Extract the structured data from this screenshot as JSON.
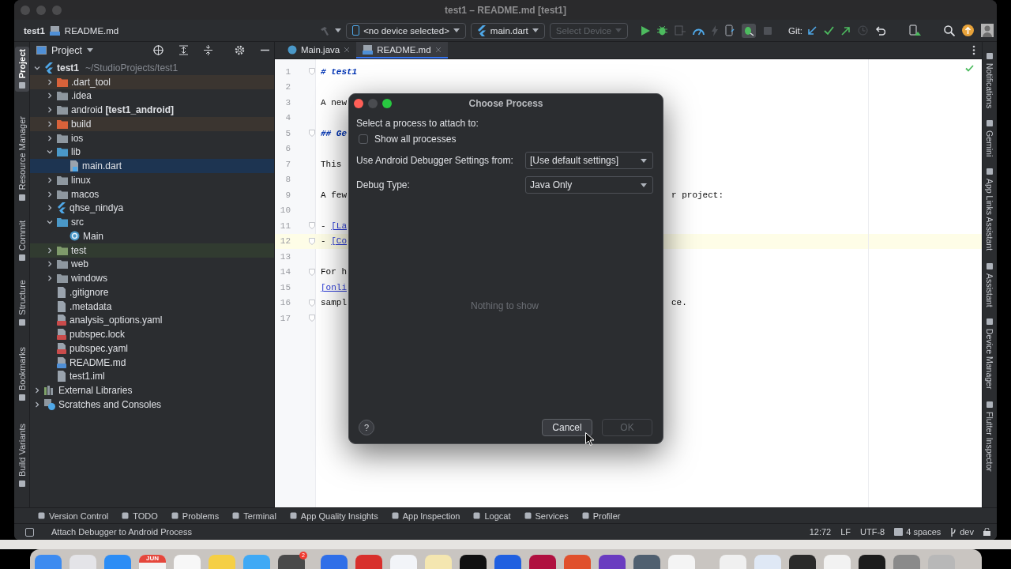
{
  "window": {
    "title": "test1 – README.md [test1]"
  },
  "toolbar": {
    "project": "test1",
    "file": "README.md",
    "device_selector": "<no device selected>",
    "run_config": "main.dart",
    "device_dropdown": {
      "label": "Select Device",
      "disabled": true
    },
    "git_label": "Git:"
  },
  "left_stripe": [
    {
      "label": "Project",
      "selected": true
    },
    {
      "label": "Resource Manager",
      "selected": false
    },
    {
      "label": "Commit",
      "selected": false
    },
    {
      "label": "Structure",
      "selected": false
    },
    {
      "label": "Bookmarks",
      "selected": false
    },
    {
      "label": "Build Variants",
      "selected": false
    }
  ],
  "right_stripe": [
    {
      "label": "Notifications",
      "selected": false
    },
    {
      "label": "Gemini",
      "selected": false
    },
    {
      "label": "App Links Assistant",
      "selected": false
    },
    {
      "label": "Assistant",
      "selected": false
    },
    {
      "label": "Device Manager",
      "selected": false
    },
    {
      "label": "Flutter Inspector",
      "selected": false
    }
  ],
  "project_panel": {
    "title": "Project",
    "tree": [
      {
        "label": "test1",
        "path": "~/StudioProjects/test1",
        "kind": "flutter-module",
        "expanded": true,
        "selected": false,
        "children": [
          {
            "label": ".dart_tool",
            "kind": "folder-excluded",
            "expanded": false,
            "selected": false
          },
          {
            "label": ".idea",
            "kind": "folder",
            "expanded": false,
            "selected": false
          },
          {
            "label": "android **[test1_android]**",
            "kind": "folder-module",
            "expanded": false,
            "selected": false
          },
          {
            "label": "build",
            "kind": "folder-excluded",
            "expanded": false,
            "selected": false
          },
          {
            "label": "ios",
            "kind": "folder-module",
            "expanded": false,
            "selected": false
          },
          {
            "label": "lib",
            "kind": "folder-source",
            "expanded": true,
            "selected": false,
            "children": [
              {
                "label": "main.dart",
                "kind": "dart-file",
                "selected": true
              }
            ]
          },
          {
            "label": "linux",
            "kind": "folder",
            "expanded": false,
            "selected": false
          },
          {
            "label": "macos",
            "kind": "folder",
            "expanded": false,
            "selected": false
          },
          {
            "label": "qhse_nindya",
            "kind": "flutter-module",
            "expanded": false,
            "selected": false
          },
          {
            "label": "src",
            "kind": "folder-source",
            "expanded": true,
            "selected": false,
            "children": [
              {
                "label": "Main",
                "kind": "java-class",
                "selected": false
              }
            ]
          },
          {
            "label": "test",
            "kind": "folder-test",
            "expanded": false,
            "selected": false
          },
          {
            "label": "web",
            "kind": "folder-module",
            "expanded": false,
            "selected": false
          },
          {
            "label": "windows",
            "kind": "folder",
            "expanded": false,
            "selected": false
          },
          {
            "label": ".gitignore",
            "kind": "text-file",
            "selected": false
          },
          {
            "label": ".metadata",
            "kind": "text-file",
            "selected": false
          },
          {
            "label": "analysis_options.yaml",
            "kind": "yaml-file",
            "selected": false
          },
          {
            "label": "pubspec.lock",
            "kind": "yaml-file",
            "selected": false
          },
          {
            "label": "pubspec.yaml",
            "kind": "yaml-file",
            "selected": false
          },
          {
            "label": "README.md",
            "kind": "markdown-file",
            "selected": false
          },
          {
            "label": "test1.iml",
            "kind": "text-file",
            "selected": false
          }
        ]
      },
      {
        "label": "External Libraries",
        "kind": "libraries",
        "expanded": false,
        "selected": false
      },
      {
        "label": "Scratches and Consoles",
        "kind": "scratches",
        "expanded": false,
        "selected": false
      }
    ]
  },
  "editor": {
    "tabs": [
      {
        "label": "Main.java",
        "kind": "java",
        "selected": false
      },
      {
        "label": "README.md",
        "kind": "markdown",
        "selected": true
      }
    ],
    "lines": [
      {
        "number": "1",
        "kind": "heading",
        "text": "# test1",
        "fold": true,
        "current": false
      },
      {
        "number": "2",
        "kind": "text",
        "fold": false,
        "current": false
      },
      {
        "number": "3",
        "kind": "text",
        "text": "A new",
        "fold": false,
        "current": false
      },
      {
        "number": "4",
        "kind": "text",
        "fold": false,
        "current": false
      },
      {
        "number": "5",
        "kind": "heading",
        "text": "## Ge",
        "fold": true,
        "current": false
      },
      {
        "number": "6",
        "kind": "text",
        "fold": false,
        "current": false
      },
      {
        "number": "7",
        "kind": "text",
        "text": "This",
        "fold": false,
        "current": false
      },
      {
        "number": "8",
        "kind": "text",
        "fold": false,
        "current": false
      },
      {
        "number": "9",
        "kind": "text",
        "text": "A few",
        "right": "r project:",
        "fold": false,
        "current": false
      },
      {
        "number": "10",
        "kind": "text",
        "fold": false,
        "current": false
      },
      {
        "number": "11",
        "kind": "link-item",
        "bullet": "-",
        "text": "[La",
        "fold": true,
        "current": false
      },
      {
        "number": "12",
        "kind": "link-item",
        "bullet": "-",
        "text": "[Co",
        "fold": true,
        "current": true
      },
      {
        "number": "13",
        "kind": "text",
        "fold": false,
        "current": false
      },
      {
        "number": "14",
        "kind": "text",
        "text": "For h",
        "fold": true,
        "current": false
      },
      {
        "number": "15",
        "kind": "link",
        "text": "[onli",
        "fold": false,
        "current": false
      },
      {
        "number": "16",
        "kind": "text",
        "text": "sampl",
        "right": "ce.",
        "fold": true,
        "current": false
      },
      {
        "number": "17",
        "kind": "text",
        "fold": true,
        "current": false
      }
    ]
  },
  "dialog": {
    "title": "Choose Process",
    "prompt": "Select a process to attach to:",
    "show_all": {
      "label": "Show all processes",
      "checked": false
    },
    "fields": [
      {
        "label": "Use Android Debugger Settings from:",
        "value": "[Use default settings]"
      },
      {
        "label": "Debug Type:",
        "value": "Java Only"
      }
    ],
    "empty_text": "Nothing to show",
    "help": "?",
    "buttons": [
      {
        "label": "Cancel",
        "disabled": false
      },
      {
        "label": "OK",
        "disabled": true
      }
    ]
  },
  "tool_windows": [
    "Version Control",
    "TODO",
    "Problems",
    "Terminal",
    "App Quality Insights",
    "App Inspection",
    "Logcat",
    "Services",
    "Profiler"
  ],
  "status_bar": {
    "message": "Attach Debugger to Android Process",
    "position": "12:72",
    "line_separator": "LF",
    "encoding": "UTF-8",
    "indent": "4 spaces",
    "branch": "dev"
  },
  "dock": {
    "apps": [
      {
        "color": "#3d8bf0"
      },
      {
        "color": "#e4e4e8"
      },
      {
        "color": "#2c8df5"
      },
      {
        "color": "#f4f4f4",
        "label": "JUN"
      },
      {
        "color": "#f7f7f7"
      },
      {
        "color": "#f5cf45"
      },
      {
        "color": "#3fa9f5"
      },
      {
        "color": "#4a4a4a",
        "badge": "2"
      }
    ],
    "running": [
      {
        "color": "#2f6fe8"
      },
      {
        "color": "#d8302c"
      },
      {
        "color": "#f2f4f8"
      },
      {
        "color": "#f4e6b0"
      },
      {
        "color": "#111111"
      },
      {
        "color": "#2060e0"
      },
      {
        "color": "#b01040"
      },
      {
        "color": "#e0502c"
      },
      {
        "color": "#6a3cc0"
      },
      {
        "color": "#506070"
      },
      {
        "color": "#f4f4f4"
      }
    ],
    "files": [
      {
        "color": "#f0f0f0"
      },
      {
        "color": "#dfe8f5"
      },
      {
        "color": "#2a2a2a"
      },
      {
        "color": "#f2f2f2"
      },
      {
        "color": "#1c1c1c"
      },
      {
        "color": "#8a8a8a"
      },
      {
        "color": "#b8b8b8"
      }
    ]
  }
}
